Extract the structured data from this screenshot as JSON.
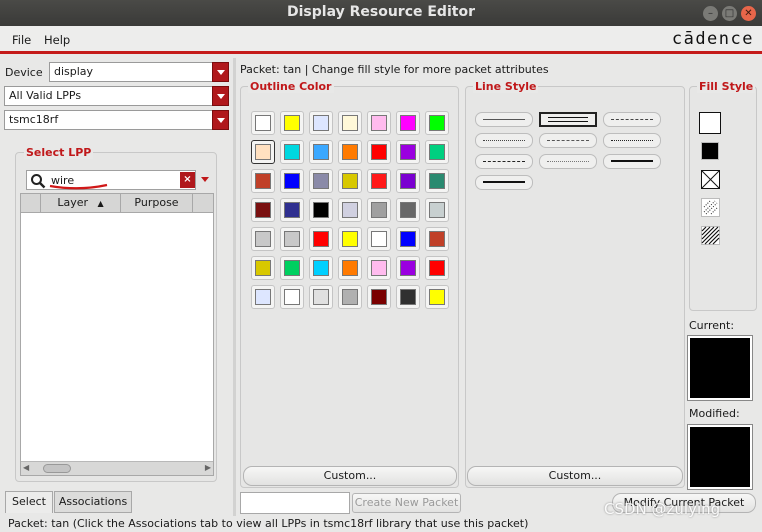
{
  "window": {
    "title": "Display Resource Editor"
  },
  "menu": {
    "file": "File",
    "help": "Help"
  },
  "brand": {
    "logo": "cādence"
  },
  "left": {
    "device_label": "Device",
    "device_value": "display",
    "lpp_filter": "All Valid LPPs",
    "library": "tsmc18rf",
    "select_lpp_title": "Select LPP",
    "search_value": "wire",
    "col_layer": "Layer",
    "col_purpose": "Purpose",
    "tab_select": "Select",
    "tab_associations": "Associations"
  },
  "packet_info": "Packet: tan | Change fill style for more packet attributes",
  "outline": {
    "title": "Outline Color",
    "custom": "Custom...",
    "colors": [
      [
        "#ffffff",
        "#ffff00",
        "#dde6ff",
        "#fff8d8",
        "#ffbbee",
        "#ff00ff",
        "#00ff00"
      ],
      [
        "#ffe0c0",
        "#00d8e0",
        "#3aa8ff",
        "#ff7a00",
        "#ff0000",
        "#9a00e0",
        "#00d080"
      ],
      [
        "#c04028",
        "#0000ff",
        "#8a8aa8",
        "#d8c800",
        "#ff1818",
        "#7a00d0",
        "#2a8a70"
      ],
      [
        "#7a1010",
        "#303090",
        "#000000",
        "#d0d0e0",
        "#a0a0a0",
        "#686868",
        "#c8d0d0"
      ],
      [
        "#c8c8c8",
        "#c8c8c8",
        "#ff0000",
        "#ffff00",
        "#ffffff",
        "#0000ff",
        "#c04028"
      ],
      [
        "#d8c800",
        "#00d060",
        "#00d0ff",
        "#ff7a00",
        "#ffbbee",
        "#9a00e0",
        "#ff0000"
      ],
      [
        "#dde6ff",
        "#ffffff",
        "#e0e0e0",
        "#b0b0b0",
        "#7a0000",
        "#303030",
        "#ffff00"
      ]
    ],
    "selected": [
      1,
      0
    ]
  },
  "linestyle": {
    "title": "Line Style",
    "custom": "Custom..."
  },
  "fill": {
    "title": "Fill Style",
    "current_label": "Current:",
    "modified_label": "Modified:"
  },
  "bottom": {
    "packet_input": "",
    "create_packet": "Create New Packet",
    "modify_packet": "Modify Current Packet",
    "status": "Packet: tan (Click the Associations tab to view all LPPs in tsmc18rf library that use this packet)"
  },
  "watermark": "CSDN @zulying"
}
